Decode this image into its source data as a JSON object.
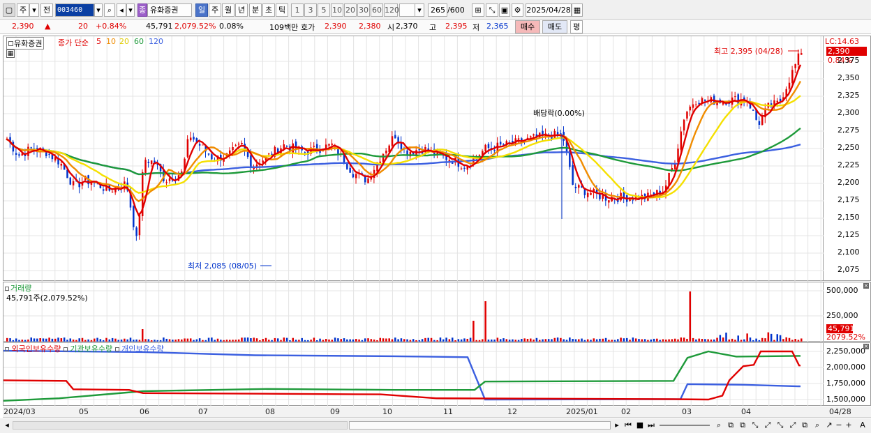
{
  "toolbar": {
    "market": "주",
    "prev": "전",
    "code": "003460",
    "stock_badge": "종",
    "stock_name": "유화증권",
    "periods": [
      "일",
      "주",
      "월",
      "년",
      "분",
      "초",
      "틱"
    ],
    "intervals": [
      "1",
      "3",
      "5",
      "10",
      "20",
      "30",
      "60",
      "120"
    ],
    "count": "265",
    "max": "/600",
    "date": "2025/04/28"
  },
  "quote": {
    "price": "2,390",
    "arrow": "▲",
    "change": "20",
    "change_pct": "+0.84%",
    "volume": "45,791",
    "volume_pct": "2,079.52%",
    "turnover": "0.08%",
    "amount": "109백만",
    "hoga_label": "호가",
    "ask": "2,390",
    "bid": "2,380",
    "open_label": "시",
    "open": "2,370",
    "high_label": "고",
    "high": "2,395",
    "low_label": "저",
    "low": "2,365",
    "buy": "매수",
    "sell": "매도",
    "eval": "평"
  },
  "price_panel": {
    "legend": {
      "name": "유화증권",
      "ma_label": "종가 단순",
      "ma": [
        "5",
        "10",
        "20",
        "60",
        "120"
      ]
    },
    "ticks": [
      "2,375",
      "2,350",
      "2,325",
      "2,300",
      "2,275",
      "2,250",
      "2,225",
      "2,200",
      "2,175",
      "2,150",
      "2,125",
      "2,100",
      "2,075"
    ],
    "lc": "LC:14.63",
    "cur_price": "2,390",
    "cur_pct": "0.84%",
    "high_note": "최고 2,395 (04/28)",
    "low_note": "최저 2,085 (08/05)",
    "dividend_note": "배당락(0.00%)"
  },
  "volume_panel": {
    "title": "거래량",
    "value": "45,791주(2,079.52%)",
    "ticks": [
      "500,000",
      "250,000"
    ],
    "cur": "45,791",
    "cur_pct": "2079.52%"
  },
  "holding_panel": {
    "titles": [
      "외국인보유수량",
      "기관보유수량",
      "개인보유수량"
    ],
    "ticks": [
      "2,250,000",
      "2,000,000",
      "1,750,000",
      "1,500,000"
    ]
  },
  "xaxis": {
    "labels": [
      "2024/03",
      "05",
      "06",
      "07",
      "08",
      "09",
      "10",
      "11",
      "12",
      "2025/01",
      "02",
      "03",
      "04",
      "04/28"
    ]
  },
  "colors": {
    "up": "#e00000",
    "down": "#0033cc",
    "ma5": "#e00000",
    "ma10": "#f08c00",
    "ma20": "#f5e000",
    "ma60": "#1e9a3a",
    "ma120": "#3b5fe0"
  }
}
